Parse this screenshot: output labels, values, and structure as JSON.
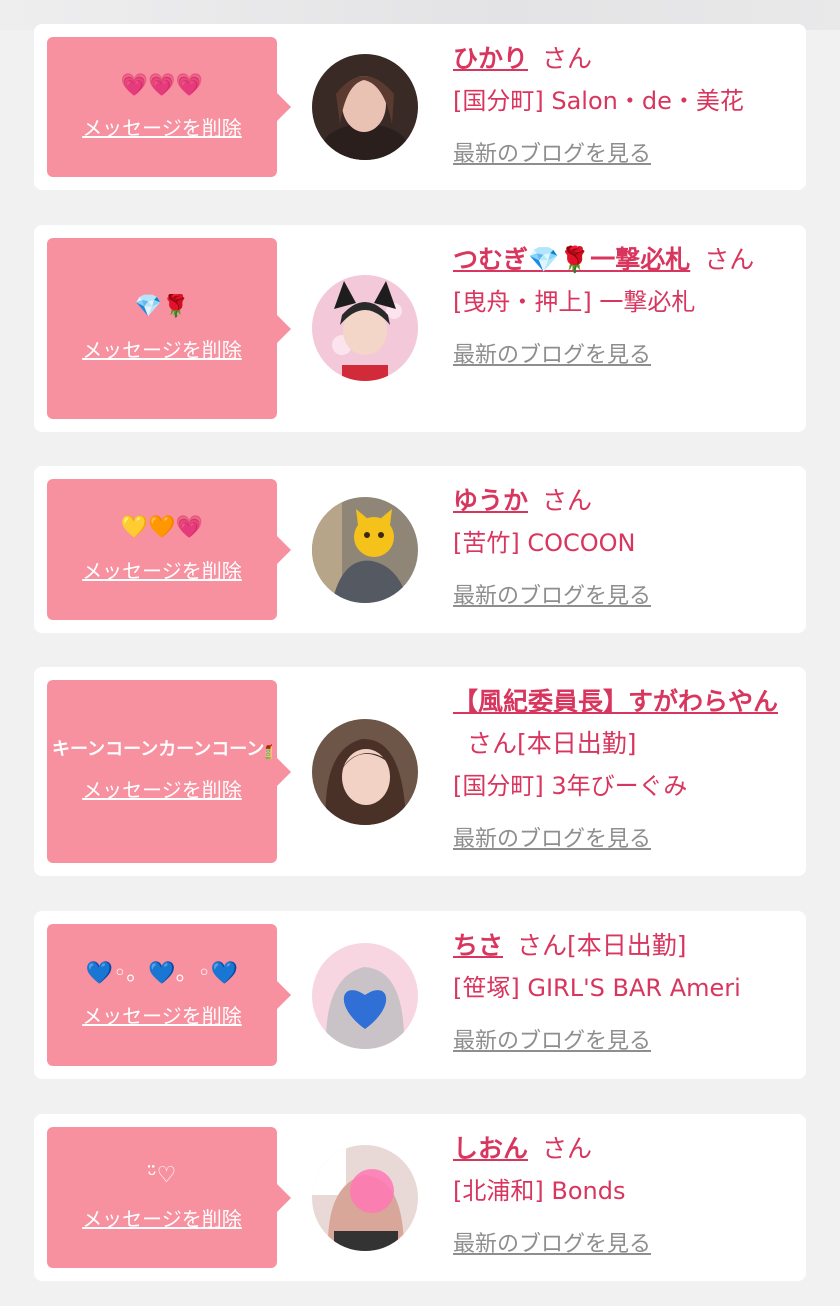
{
  "delete_label": "メッセージを削除",
  "blog_label": "最新のブログを見る",
  "san_label": "さん",
  "colors": {
    "accent": "#d8365e",
    "bubble": "#f7909f",
    "link_gray": "#8e8e8e",
    "background": "#f1f1f2"
  },
  "messages": [
    {
      "message": "💗💗💗",
      "name": "ひかり",
      "suffix": "",
      "shop": "[国分町] Salon・de・美花",
      "avatar": "photo-avatar"
    },
    {
      "message": "💎🌹",
      "name": "つむぎ💎🌹一撃必札",
      "suffix": "",
      "shop": "[曳舟・押上] 一撃必札",
      "avatar": "photo-avatar"
    },
    {
      "message": "💛🧡💗",
      "name": "ゆうか",
      "suffix": "",
      "shop": "[苦竹] COCOON",
      "avatar": "photo-avatar"
    },
    {
      "message": "キーンコーンカーンコーン🏫",
      "name": "【風紀委員長】すがわらやん",
      "suffix": "[本日出勤]",
      "shop": "[国分町] 3年びーぐみ",
      "avatar": "photo-avatar"
    },
    {
      "message": "💙◦。💙。◦💙",
      "name": "ちさ",
      "suffix": "[本日出勤]",
      "shop": "[笹塚] GIRL'S BAR Ameri",
      "avatar": "photo-avatar"
    },
    {
      "message": "ᵕ̈♡",
      "name": "しおん",
      "suffix": "",
      "shop": "[北浦和] Bonds",
      "avatar": "photo-avatar"
    }
  ]
}
